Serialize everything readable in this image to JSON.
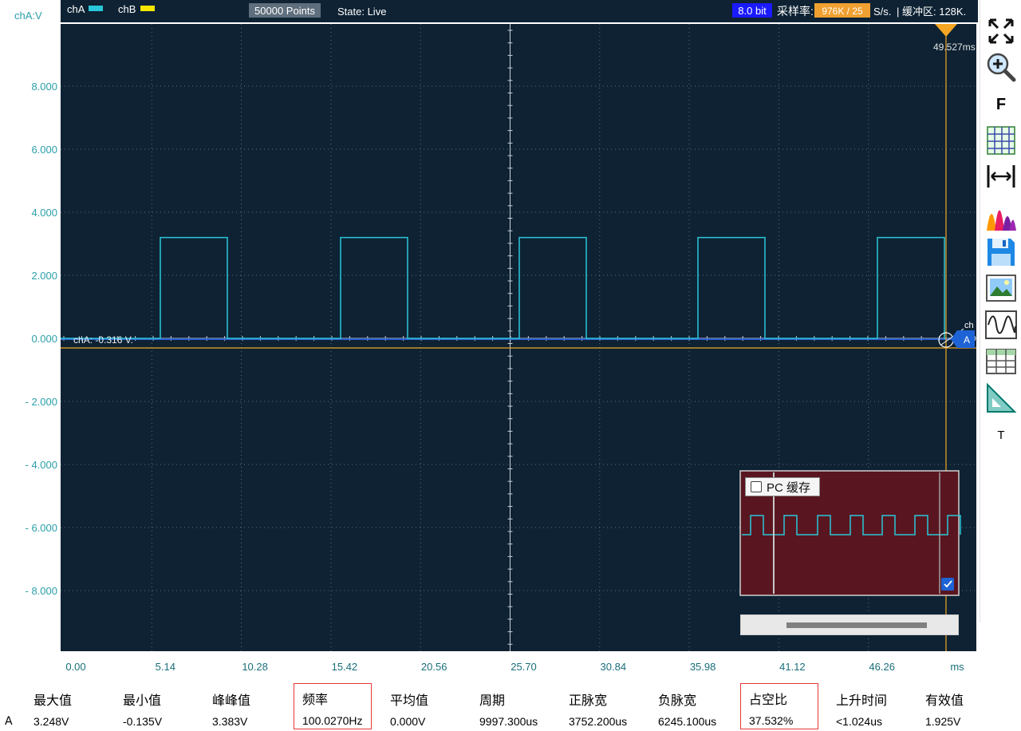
{
  "top_bar": {
    "channel_a": "chA",
    "channel_b": "chB",
    "points": "50000 Points",
    "state": "State: Live",
    "bit_depth": "8.0 bit",
    "sample_rate_label": "采样率:",
    "sample_rate_value": "976K / 25",
    "sample_rate_unit": "S/s.",
    "buffer_label": "| 缓冲区: 128K."
  },
  "axis": {
    "y_label": "chA:V",
    "y_ticks": [
      "8.000",
      "6.000",
      "4.000",
      "2.000",
      "0.000",
      "- 2.000",
      "- 4.000",
      "- 6.000",
      "- 8.000"
    ],
    "x_ticks": [
      "0.00",
      "5.14",
      "10.28",
      "15.42",
      "20.56",
      "25.70",
      "30.84",
      "35.98",
      "41.12",
      "46.26"
    ],
    "x_unit": "ms"
  },
  "markers": {
    "trigger_time": "49.527ms",
    "channel_level": "chA: -0.316 V.",
    "channel_tag": "A",
    "channel_tag_small": "ch"
  },
  "preview": {
    "pc_cache_label": "PC 缓存"
  },
  "toolbar": {
    "items": [
      {
        "name": "fullscreen-icon"
      },
      {
        "name": "zoom-in-icon"
      },
      {
        "name": "f-button",
        "label": "F"
      },
      {
        "name": "grid-icon"
      },
      {
        "name": "horizontal-measure-icon"
      },
      {
        "name": "spectrum-icon"
      },
      {
        "name": "save-icon"
      },
      {
        "name": "screenshot-icon"
      },
      {
        "name": "waveform-icon"
      },
      {
        "name": "table-icon"
      },
      {
        "name": "ruler-icon"
      },
      {
        "name": "text-button",
        "label": "T"
      }
    ]
  },
  "measurements": {
    "channel": "A",
    "columns": [
      {
        "label": "最大值",
        "value": "3.248V",
        "highlight": false
      },
      {
        "label": "最小值",
        "value": "-0.135V",
        "highlight": false
      },
      {
        "label": "峰峰值",
        "value": "3.383V",
        "highlight": false
      },
      {
        "label": "频率",
        "value": "100.0270Hz",
        "highlight": true
      },
      {
        "label": "平均值",
        "value": "0.000V",
        "highlight": false
      },
      {
        "label": "周期",
        "value": "9997.300us",
        "highlight": false
      },
      {
        "label": "正脉宽",
        "value": "3752.200us",
        "highlight": false
      },
      {
        "label": "负脉宽",
        "value": "6245.100us",
        "highlight": false
      },
      {
        "label": "占空比",
        "value": "37.532%",
        "highlight": true
      },
      {
        "label": "上升时间",
        "value": "<1.024us",
        "highlight": false
      },
      {
        "label": "有效值",
        "value": "1.925V",
        "highlight": false
      }
    ]
  },
  "colors": {
    "screen_bg": "#0e2233",
    "trace": "#29c7d9",
    "trigger": "#f5a623",
    "axis_text": "#2a9fa8",
    "preview_bg": "#5a1620",
    "bit_badge": "#1a1aff",
    "rate_badge": "#f0a030"
  }
}
